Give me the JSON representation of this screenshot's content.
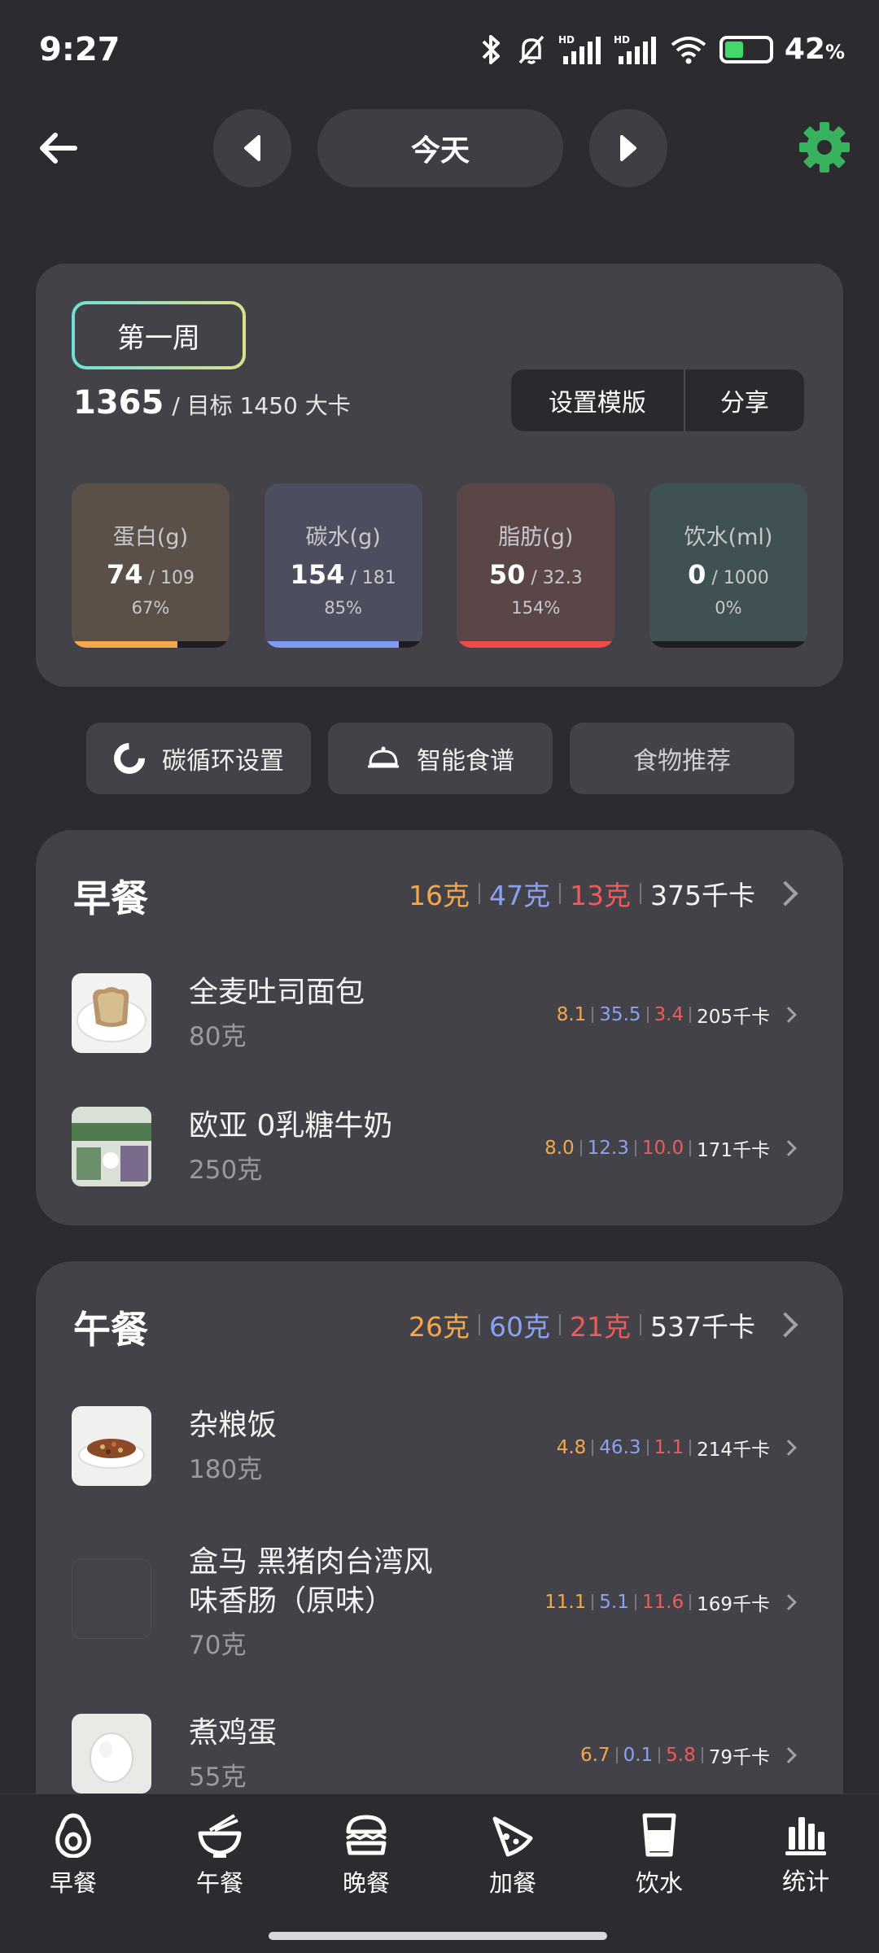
{
  "status": {
    "time": "9:27",
    "battery_pct": "42",
    "pct_sign": "%",
    "battery_level": 0.42
  },
  "nav": {
    "day": "今天"
  },
  "summary": {
    "week": "第一周",
    "kcal": "1365",
    "target_text": "/ 目标 1450 大卡",
    "template_btn": "设置模版",
    "share_btn": "分享",
    "macros": [
      {
        "label": "蛋白(g)",
        "value": "74",
        "total": "/ 109",
        "pct": "67%",
        "fill": 0.67,
        "color": "#f5a84a",
        "bg": "#5a5048"
      },
      {
        "label": "碳水(g)",
        "value": "154",
        "total": "/ 181",
        "pct": "85%",
        "fill": 0.85,
        "color": "#7f9cf5",
        "bg": "#4c4d5e"
      },
      {
        "label": "脂肪(g)",
        "value": "50",
        "total": "/ 32.3",
        "pct": "154%",
        "fill": 1.0,
        "color": "#ee4b4b",
        "bg": "#5a4547"
      },
      {
        "label": "饮水(ml)",
        "value": "0",
        "total": "/ 1000",
        "pct": "0%",
        "fill": 0,
        "color": "#4fc3c3",
        "bg": "#3f5153"
      }
    ]
  },
  "pills": {
    "carb_cycle": "碳循环设置",
    "smart_recipe": "智能食谱",
    "food_recommend": "食物推荐"
  },
  "breakfast": {
    "title": "早餐",
    "protein": "16克",
    "carb": "47克",
    "fat": "13克",
    "kcal": "375千卡",
    "items": [
      {
        "name": "全麦吐司面包",
        "qty": "80克",
        "p": "8.1",
        "c": "35.5",
        "f": "3.4",
        "kcal": "205千卡"
      },
      {
        "name": "欧亚 0乳糖牛奶",
        "qty": "250克",
        "p": "8.0",
        "c": "12.3",
        "f": "10.0",
        "kcal": "171千卡"
      }
    ]
  },
  "lunch": {
    "title": "午餐",
    "protein": "26克",
    "carb": "60克",
    "fat": "21克",
    "kcal": "537千卡",
    "items": [
      {
        "name": "杂粮饭",
        "qty": "180克",
        "p": "4.8",
        "c": "46.3",
        "f": "1.1",
        "kcal": "214千卡"
      },
      {
        "name_line1": "盒马 黑猪肉台湾风",
        "name_line2": "味香肠（原味）",
        "qty": "70克",
        "p": "11.1",
        "c": "5.1",
        "f": "11.6",
        "kcal": "169千卡"
      },
      {
        "name": "煮鸡蛋",
        "qty": "55克",
        "p": "6.7",
        "c": "0.1",
        "f": "5.8",
        "kcal": "79千卡"
      }
    ]
  },
  "tabs": [
    {
      "label": "早餐",
      "icon": "avocado-icon"
    },
    {
      "label": "午餐",
      "icon": "noodle-bowl-icon"
    },
    {
      "label": "晚餐",
      "icon": "burger-icon"
    },
    {
      "label": "加餐",
      "icon": "pizza-slice-icon"
    },
    {
      "label": "饮水",
      "icon": "water-glass-icon"
    },
    {
      "label": "统计",
      "icon": "bar-chart-icon"
    }
  ]
}
